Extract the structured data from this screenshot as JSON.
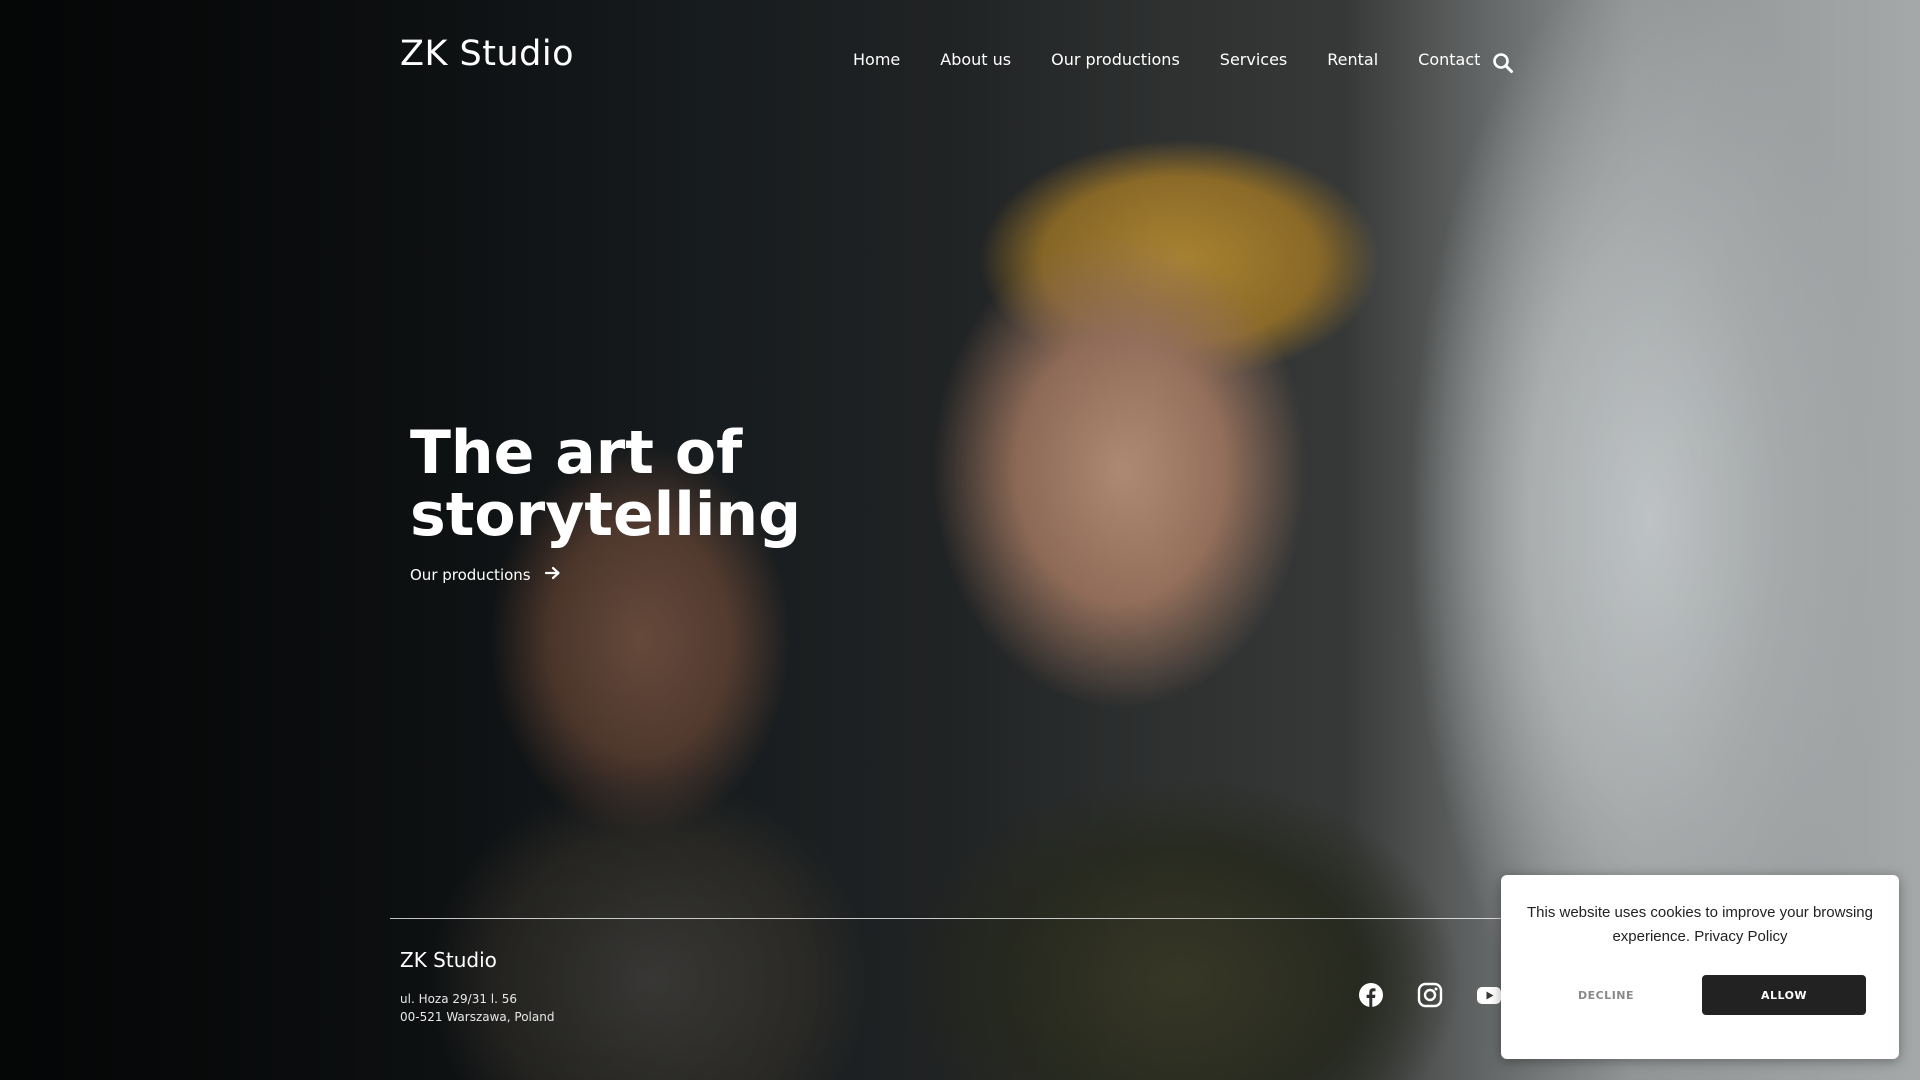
{
  "header": {
    "brand": "ZK Studio",
    "nav": [
      {
        "label": "Home"
      },
      {
        "label": "About us"
      },
      {
        "label": "Our productions"
      },
      {
        "label": "Services"
      },
      {
        "label": "Rental"
      },
      {
        "label": "Contact"
      }
    ],
    "search_icon": "search-icon"
  },
  "hero": {
    "title": "The art of storytelling",
    "cta_label": "Our productions",
    "cta_icon": "arrow-right-icon"
  },
  "footer": {
    "brand": "ZK Studio",
    "address_line1": "ul. Hoza 29/31 l. 56",
    "address_line2": "00-521 Warszawa, Poland",
    "social": [
      {
        "icon": "facebook-icon"
      },
      {
        "icon": "instagram-icon"
      },
      {
        "icon": "youtube-icon"
      }
    ]
  },
  "cookie_banner": {
    "message": "This website uses cookies to improve your browsing experience.",
    "policy_link": "Privacy Policy",
    "decline_label": "DECLINE",
    "allow_label": "ALLOW"
  },
  "colors": {
    "text": "#ffffff",
    "dialog_bg": "#ffffff",
    "allow_button": "#222222",
    "decline_text": "#8a8a8a"
  }
}
